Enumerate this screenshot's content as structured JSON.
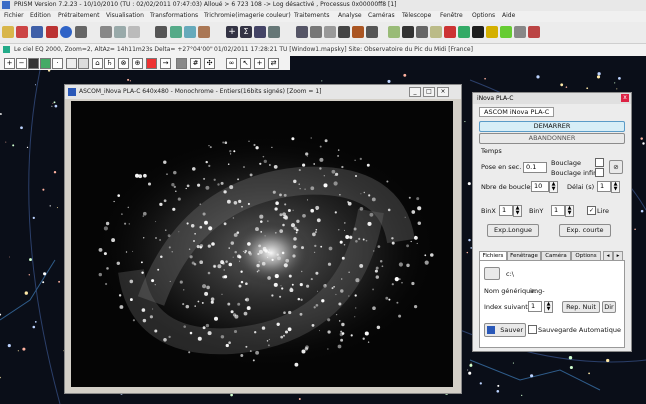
{
  "app": {
    "title": "PRISM    Version 7.2.23 - 10/10/2010   (TU : 02/02/2011 07:47:03)  Alloué > 6 723 108 -> Log désactivé , Processus 0x00000ff8 [1]"
  },
  "menu": [
    "Fichier",
    "Edition",
    "Prétraitement",
    "Visualisation",
    "Transformations",
    "Trichromie(imagerie couleur)",
    "Traitements",
    "Analyse",
    "Caméras",
    "Télescope",
    "Fenêtre",
    "Options",
    "Aide"
  ],
  "infobar": {
    "left": "Le ciel EQ 2000, Zoom=2, AltAz= 14h11m23s  Delta= +27°04'00\"",
    "right": "01/02/2011 17:28:21 TU  [Window1.mapsky]   Site: Observatoire du Pic du Midi [France]"
  },
  "image_window": {
    "title": "ASCOM_iNova PLA-C 640x480 - Monochrome - Entiers(16bits signés)  [Zoom = 1]",
    "min": "_",
    "max": "□",
    "close": "×"
  },
  "panel": {
    "title": "iNova PLA-C",
    "close": "x",
    "subtitle": "ASCOM iNova PLA-C",
    "start_button": "DEMARRER",
    "abort_button": "ABANDONNER",
    "temps_label": "Temps",
    "pose_label": "Pose en sec.",
    "pose_value": "0.1",
    "bouclage_label": "Bouclage",
    "bouclage_infini_label": "Bouclage infini",
    "nb_boucles_label": "Nbre de boucles",
    "nb_boucles_value": "10",
    "delai_label": "Délai (s)",
    "delai_value": "1",
    "binx_label": "BinX",
    "binx_value": "1",
    "biny_label": "BinY",
    "biny_value": "1",
    "lire_label": "Lire",
    "exp_longue": "Exp.Longue",
    "exp_courte": "Exp. courte",
    "tabs": [
      "Fichiers",
      "Fenêtrage",
      "Caméra",
      "Options"
    ],
    "path_value": "c:\\",
    "nom_label": "Nom générique:",
    "nom_value": "img-",
    "index_label": "Index suivant",
    "index_value": "1",
    "rep_nuit": "Rep. Nuit",
    "dir_btn": "Dir",
    "save_button": "Sauver",
    "auto_save_label": "Sauvegarde Automatique"
  }
}
